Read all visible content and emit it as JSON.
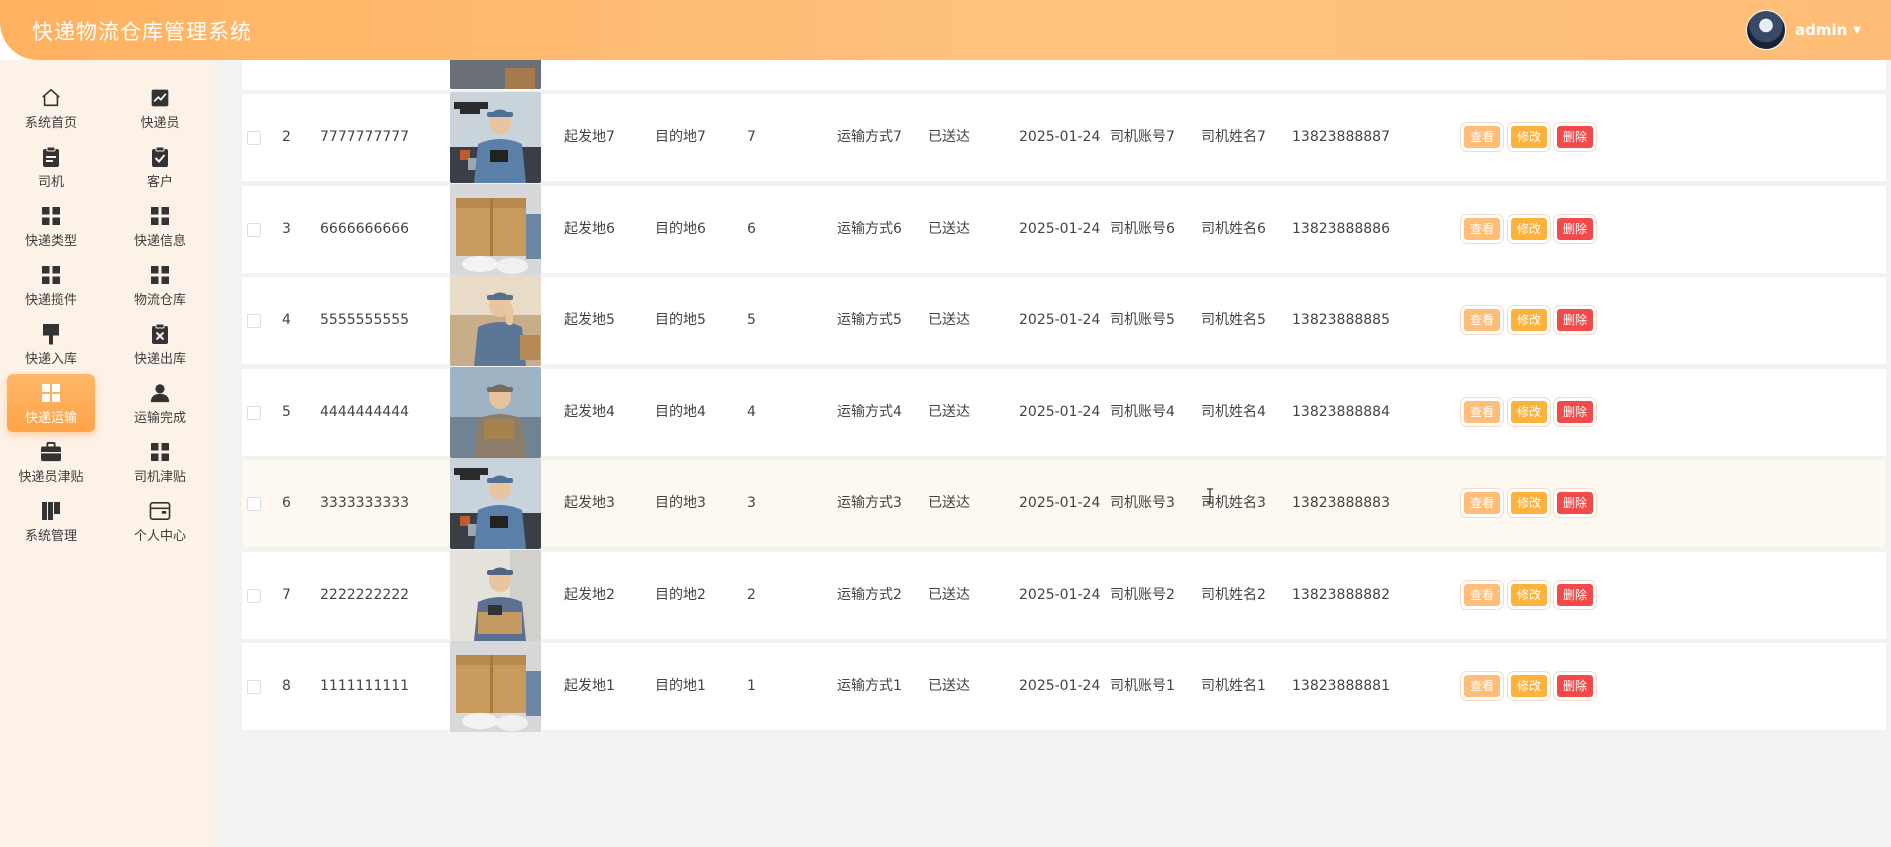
{
  "app": {
    "title": "快递物流仓库管理系统"
  },
  "user": {
    "name": "admin"
  },
  "sidebar": {
    "items": [
      {
        "label": "系统首页",
        "icon": "home-icon"
      },
      {
        "label": "快递员",
        "icon": "chart-icon"
      },
      {
        "label": "司机",
        "icon": "clipboard-icon"
      },
      {
        "label": "客户",
        "icon": "clipboard-check-icon"
      },
      {
        "label": "快递类型",
        "icon": "grid-icon"
      },
      {
        "label": "快递信息",
        "icon": "grid-icon"
      },
      {
        "label": "快递揽件",
        "icon": "grid-icon"
      },
      {
        "label": "物流仓库",
        "icon": "grid-icon"
      },
      {
        "label": "快递入库",
        "icon": "brush-icon"
      },
      {
        "label": "快递出库",
        "icon": "clipboard-x-icon"
      },
      {
        "label": "快递运输",
        "icon": "grid-icon",
        "active": true
      },
      {
        "label": "运输完成",
        "icon": "user-icon"
      },
      {
        "label": "快递员津贴",
        "icon": "briefcase-icon"
      },
      {
        "label": "司机津贴",
        "icon": "grid-icon"
      },
      {
        "label": "系统管理",
        "icon": "book-icon"
      },
      {
        "label": "个人中心",
        "icon": "wallet-icon"
      }
    ]
  },
  "table": {
    "actions": {
      "view": "查看",
      "edit": "修改",
      "delete": "删除"
    },
    "rows": [
      {
        "index": "2",
        "code": "7777777777",
        "image": "drone-courier",
        "origin": "起发地7",
        "dest": "目的地7",
        "qty": "7",
        "method": "运输方式7",
        "status": "已送达",
        "date": "2025-01-24",
        "driver_account": "司机账号7",
        "driver_name": "司机姓名7",
        "phone": "13823888887"
      },
      {
        "index": "3",
        "code": "6666666666",
        "image": "package-handover",
        "origin": "起发地6",
        "dest": "目的地6",
        "qty": "6",
        "method": "运输方式6",
        "status": "已送达",
        "date": "2025-01-24",
        "driver_account": "司机账号6",
        "driver_name": "司机姓名6",
        "phone": "13823888886"
      },
      {
        "index": "4",
        "code": "5555555555",
        "image": "courier-waving",
        "origin": "起发地5",
        "dest": "目的地5",
        "qty": "5",
        "method": "运输方式5",
        "status": "已送达",
        "date": "2025-01-24",
        "driver_account": "司机账号5",
        "driver_name": "司机姓名5",
        "phone": "13823888885"
      },
      {
        "index": "5",
        "code": "4444444444",
        "image": "courier-carrying-box",
        "origin": "起发地4",
        "dest": "目的地4",
        "qty": "4",
        "method": "运输方式4",
        "status": "已送达",
        "date": "2025-01-24",
        "driver_account": "司机账号4",
        "driver_name": "司机姓名4",
        "phone": "13823888884"
      },
      {
        "index": "6",
        "code": "3333333333",
        "image": "drone-courier",
        "origin": "起发地3",
        "dest": "目的地3",
        "qty": "3",
        "method": "运输方式3",
        "status": "已送达",
        "date": "2025-01-24",
        "driver_account": "司机账号3",
        "driver_name": "司机姓名3",
        "phone": "13823888883"
      },
      {
        "index": "7",
        "code": "2222222222",
        "image": "courier-scanning",
        "origin": "起发地2",
        "dest": "目的地2",
        "qty": "2",
        "method": "运输方式2",
        "status": "已送达",
        "date": "2025-01-24",
        "driver_account": "司机账号2",
        "driver_name": "司机姓名2",
        "phone": "13823888882"
      },
      {
        "index": "8",
        "code": "1111111111",
        "image": "package-handover",
        "origin": "起发地1",
        "dest": "目的地1",
        "qty": "1",
        "method": "运输方式1",
        "status": "已送达",
        "date": "2025-01-24",
        "driver_account": "司机账号1",
        "driver_name": "司机姓名1",
        "phone": "13823888881"
      }
    ]
  },
  "colors": {
    "header": "#ffb260",
    "sidebar_bg": "#fdf2e8",
    "active_menu": "#ffa349",
    "view_button": "#ffbd7a",
    "edit_button": "#ffb23b",
    "delete_button": "#f44949"
  }
}
